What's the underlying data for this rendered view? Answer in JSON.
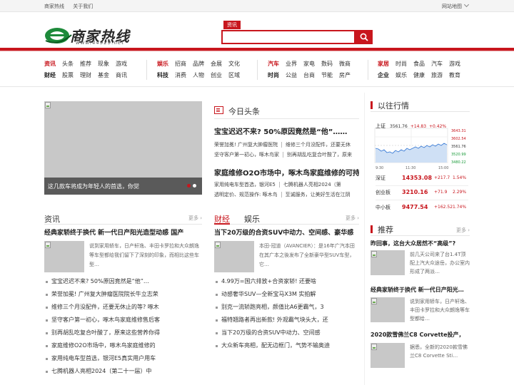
{
  "topbar": {
    "links": [
      "商家热线",
      "关于我们"
    ],
    "sitemap": "网站地图"
  },
  "logo": {
    "text": "商家热线",
    "url": "www.44929.net"
  },
  "search": {
    "tab": "资讯",
    "placeholder": "",
    "value": ""
  },
  "nav": {
    "groups": [
      {
        "rows": [
          {
            "head": "资讯",
            "head_style": "hl",
            "items": [
              "头条",
              "推荐",
              "现象",
              "游戏"
            ]
          },
          {
            "head": "财经",
            "head_style": "bk",
            "items": [
              "股票",
              "理财",
              "基金",
              "商讯"
            ]
          }
        ]
      },
      {
        "rows": [
          {
            "head": "娱乐",
            "head_style": "hl",
            "items": [
              "招商",
              "品牌",
              "会展",
              "文化"
            ]
          },
          {
            "head": "科技",
            "head_style": "bk",
            "items": [
              "消费",
              "人物",
              "创业",
              "区域"
            ]
          }
        ]
      },
      {
        "rows": [
          {
            "head": "汽车",
            "head_style": "hl",
            "items": [
              "业界",
              "家电",
              "数码",
              "微商"
            ]
          },
          {
            "head": "时尚",
            "head_style": "bk",
            "items": [
              "公益",
              "台商",
              "节能",
              "房产"
            ]
          }
        ]
      },
      {
        "rows": [
          {
            "head": "家居",
            "head_style": "hl",
            "items": [
              "时尚",
              "食品",
              "汽车",
              "游戏"
            ]
          },
          {
            "head": "企业",
            "head_style": "bk",
            "items": [
              "娱乐",
              "健康",
              "旅游",
              "教育"
            ]
          }
        ]
      }
    ]
  },
  "hero": {
    "caption": "这几款车将成为年轻人的首选，你觉"
  },
  "today": {
    "title": "今日头条",
    "headline1": "宝宝迟迟不来? 50%原因竟然是“他”……",
    "sub1a": "荣誉加冕! 广州复大肿瘤医院",
    "sub1b": "维修三个月没配件，还要无休",
    "sub2a": "坚守客户第一初心，啄木鸟家",
    "sub2b": "别再胡乱吃复合叶酸了，原来",
    "headline2": "家庭维修O2O市场中，啄木鸟家庭维修的可持",
    "sub3a": "家用纯电车型首选，银河E5",
    "sub3b": "七腾机器人亮相2024（第",
    "sub4a": "透明定价、规范操作: 啄木鸟",
    "sub4b": "至诚服务，让美好生活在江阴"
  },
  "news": {
    "tab": "资讯",
    "more": "更多",
    "feat_title": "经典家轿终于换代 新一代日产阳光造型动感 国产",
    "feat_desc": "说到家用轿车，日产轩逸、丰田卡罗拉和大众朗逸等车型都给我们留下了深刻的印象，而相比这些车型…",
    "items": [
      "宝宝迟迟不来? 50%原因竟然是“他”…",
      "荣誉加冕! 广州复大肿瘤医院院长牛立志荣",
      "维修三个月没配件，还要无休止的等? 啄木",
      "坚守客户第一初心，啄木鸟家庭维修售后客",
      "别再胡乱吃复合叶酸了，原来这些营养你得",
      "家庭维修O2O市场中，啄木鸟家庭维修的",
      "家用纯电车型首选，银河E5真实用户用车",
      "七腾机器人亮相2024（第二十一届）中"
    ]
  },
  "finance": {
    "tab1": "财经",
    "tab2": "娱乐",
    "more": "更多",
    "feat_title": "当下20万级的合资SUV中动力、空间感、豪华感",
    "feat_desc": "本田-冠道（AVANCIER）：是16年广汽本田在其广本之後发布了全新豪华型SUV车型，它…",
    "items": [
      "4.99万=国六排放+合资家轿! 还要啥",
      "动感奢华SUV—全新宝马X3M 实拍解",
      "别克一流轿跑亮相，颜值比A6更霸气，3",
      "福特翘路者再出新款! 外观霸气块头大，还",
      "当下20万级的合资SUV中动力、空间感",
      "大众新车亮相，配无边框门，气势不输奥迪"
    ]
  },
  "market": {
    "title": "以往行情",
    "label": "上证",
    "index": "3561.76",
    "change": "+14.83",
    "pct": "+0.42%",
    "y_ticks": [
      "3643.31",
      "3602.54",
      "3561.76",
      "3520.99",
      "3480.22"
    ],
    "x_ticks": [
      "9:30",
      "11:30",
      "15:00"
    ],
    "rows": [
      {
        "name": "深证",
        "value": "14353.08",
        "change": "+217.7",
        "pct": "1.54%"
      },
      {
        "name": "创业板",
        "value": "3210.16",
        "change": "+71.9",
        "pct": "2.29%"
      },
      {
        "name": "中小板",
        "value": "9477.54",
        "change": "+162.52",
        "pct": "1.74%"
      }
    ]
  },
  "recommend": {
    "title": "推荐",
    "more": "更多",
    "items": [
      {
        "title": "昨回事，这台大众居然不“高级”?",
        "desc": "前几天公司来了台1.4T顶配上汽大众途岳，办公室内形成了两派…"
      },
      {
        "title": "经典家轿终于换代 新一代日产阳光…",
        "desc": "说到家用轿车，日产轩逸、丰田卡罗拉和大众朗逸等车型都给…"
      },
      {
        "title": "2020款雪佛兰C8 Corvette投产，",
        "desc": "据悉，全新的2020款雪佛兰C8 Corvette Sti…"
      }
    ]
  },
  "colors": {
    "brand_red": "#c8161d",
    "line_blue": "#3a7bd5",
    "placeholder_gray": "#c8c8c8"
  }
}
